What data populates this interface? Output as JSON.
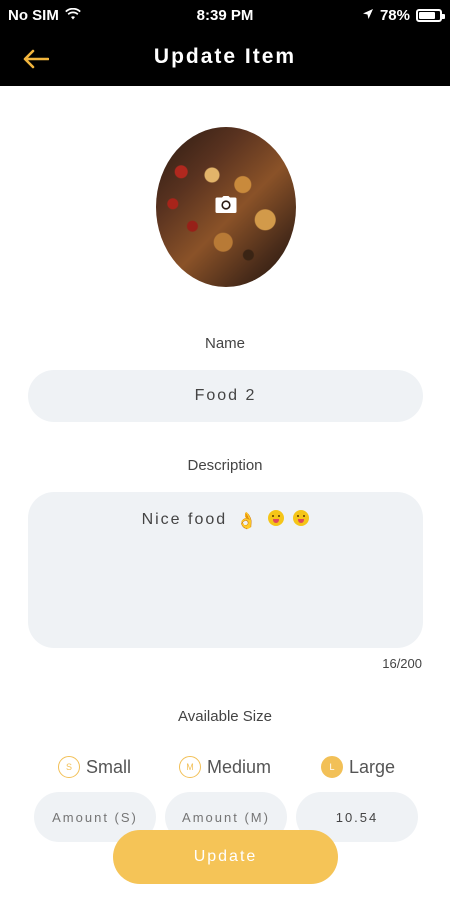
{
  "status_bar": {
    "carrier": "No SIM",
    "time": "8:39 PM",
    "battery": "78%",
    "battery_level": 0.78
  },
  "header": {
    "title": "Update Item",
    "back_icon": "arrow-left-icon"
  },
  "photo": {
    "overlay_icon": "camera-icon"
  },
  "form": {
    "name_label": "Name",
    "name_value": "Food 2",
    "description_label": "Description",
    "description_text": "Nice food",
    "description_emojis": [
      "ok-hand",
      "yum-face",
      "yum-face"
    ],
    "char_counter": "16/200",
    "size_label": "Available Size",
    "sizes": [
      {
        "badge": "S",
        "label": "Small",
        "selected": false
      },
      {
        "badge": "M",
        "label": "Medium",
        "selected": false
      },
      {
        "badge": "L",
        "label": "Large",
        "selected": true
      }
    ],
    "amount_small_placeholder": "Amount (S)",
    "amount_medium_placeholder": "Amount (M)",
    "amount_large_value": "10.54"
  },
  "actions": {
    "update_label": "Update"
  },
  "colors": {
    "accent": "#f5c457",
    "header_bg": "#000000",
    "field_bg": "#eff2f5"
  }
}
